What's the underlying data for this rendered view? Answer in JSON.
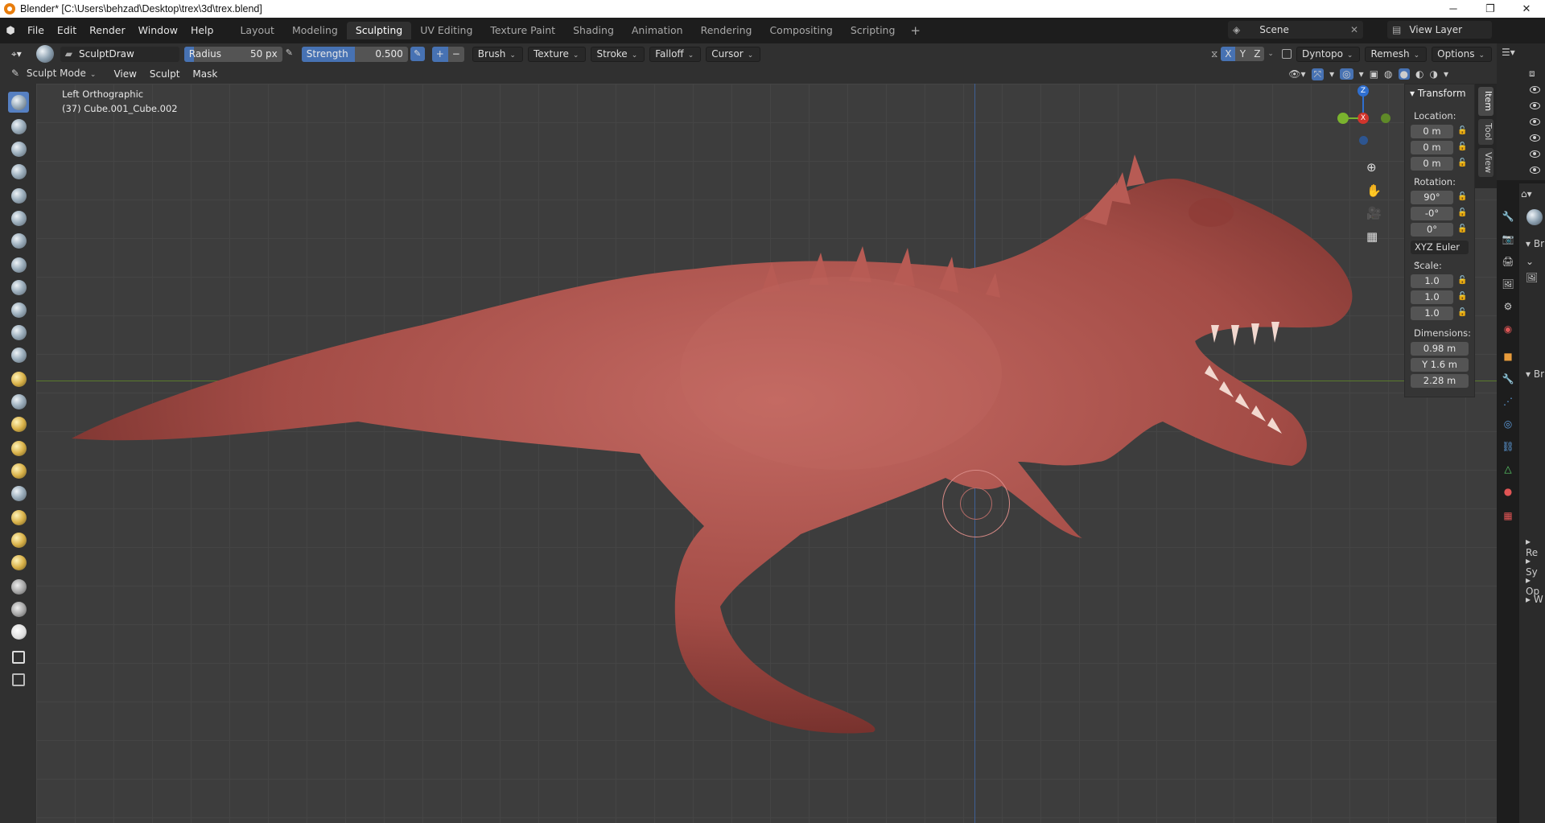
{
  "window": {
    "title": "Blender* [C:\\Users\\behzad\\Desktop\\trex\\3d\\trex.blend]",
    "minimize": "─",
    "maximize": "❐",
    "close": "✕"
  },
  "menu": [
    "File",
    "Edit",
    "Render",
    "Window",
    "Help"
  ],
  "workspaces": [
    {
      "label": "Layout",
      "active": false
    },
    {
      "label": "Modeling",
      "active": false
    },
    {
      "label": "Sculpting",
      "active": true
    },
    {
      "label": "UV Editing",
      "active": false
    },
    {
      "label": "Texture Paint",
      "active": false
    },
    {
      "label": "Shading",
      "active": false
    },
    {
      "label": "Animation",
      "active": false
    },
    {
      "label": "Rendering",
      "active": false
    },
    {
      "label": "Compositing",
      "active": false
    },
    {
      "label": "Scripting",
      "active": false
    }
  ],
  "workspace_add": "+",
  "scene": {
    "name": "Scene",
    "view_layer": "View Layer"
  },
  "tool_header": {
    "brush_name": "SculptDraw",
    "radius_label": "Radius",
    "radius_value": "50 px",
    "strength_label": "Strength",
    "strength_value": "0.500",
    "strength_fraction": 0.5,
    "plus": "+",
    "minus": "−",
    "dropdowns": [
      "Brush",
      "Texture",
      "Stroke",
      "Falloff",
      "Cursor"
    ],
    "axes": [
      "X",
      "Y",
      "Z"
    ],
    "dyntopo": "Dyntopo",
    "remesh": "Remesh",
    "options": "Options"
  },
  "mode_header": {
    "mode": "Sculpt Mode",
    "menus": [
      "View",
      "Sculpt",
      "Mask"
    ]
  },
  "viewport": {
    "view_name": "Left Orthographic",
    "object_info": "(37) Cube.001_Cube.002",
    "gizmo": {
      "z": "Z",
      "x": "X"
    },
    "model_color": "#b5564f"
  },
  "npanel": {
    "header": "Transform",
    "location_label": "Location:",
    "location": [
      "0 m",
      "0 m",
      "0 m"
    ],
    "rotation_label": "Rotation:",
    "rotation": [
      "90°",
      "-0°",
      "0°"
    ],
    "rotation_mode": "XYZ Euler",
    "scale_label": "Scale:",
    "scale": [
      "1.0",
      "1.0",
      "1.0"
    ],
    "dimensions_label": "Dimensions:",
    "dimensions": [
      "0.98 m",
      "Y  1.6 m",
      "2.28 m"
    ],
    "tabs": [
      "Item",
      "Tool",
      "View"
    ]
  },
  "properties_partial": [
    "Br",
    "Br",
    "Re",
    "Sy",
    "Op",
    "W"
  ],
  "colors": {
    "accent": "#5680c2",
    "bg": "#303030",
    "header": "#1d1d1d"
  }
}
